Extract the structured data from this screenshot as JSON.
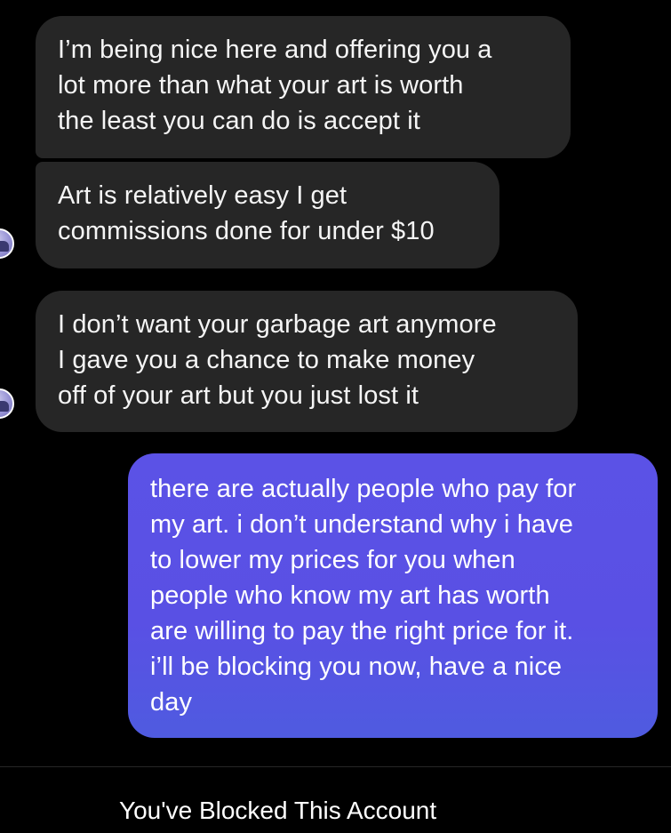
{
  "conversation": {
    "messages": [
      {
        "direction": "received",
        "text": "I’m being nice here and offering you a\nlot more than what your art is worth\nthe least you can do is accept it"
      },
      {
        "direction": "received",
        "text": "Art is relatively easy I get\ncommissions done for under $10"
      },
      {
        "direction": "received",
        "text": "I don’t want your garbage art anymore\nI gave you a chance to make money\noff of your art but you just lost it"
      },
      {
        "direction": "sent",
        "text": "there are actually people who pay for\nmy art. i don’t understand why i have\nto lower my prices for you when\npeople who know my art has worth\nare willing to pay the right price for it.\ni’ll be blocking you now, have a nice\nday"
      }
    ],
    "avatar_icon": "profile-avatar"
  },
  "footer": {
    "blocked_notice": "You've Blocked This Account"
  },
  "colors": {
    "background": "#000000",
    "received_bubble": "#262626",
    "sent_bubble": "#5a52e5",
    "text": "#ffffff"
  }
}
